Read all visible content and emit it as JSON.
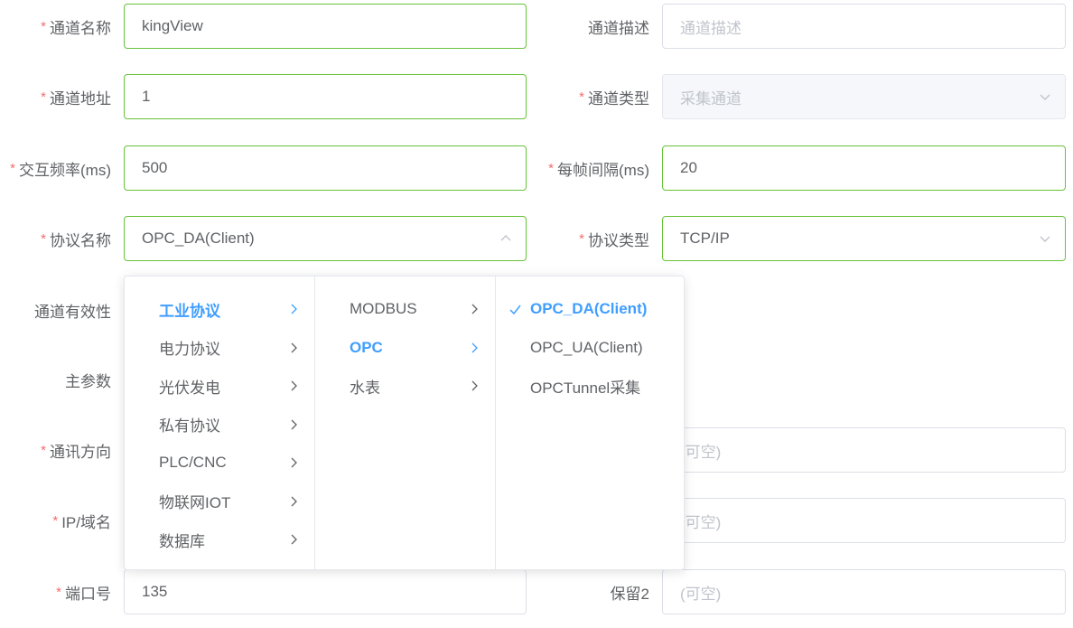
{
  "form": {
    "channel_name": {
      "label": "通道名称",
      "value": "kingView",
      "required": true
    },
    "channel_desc": {
      "label": "通道描述",
      "placeholder": "通道描述",
      "required": false
    },
    "channel_addr": {
      "label": "通道地址",
      "value": "1",
      "required": true
    },
    "channel_type": {
      "label": "通道类型",
      "placeholder": "采集通道",
      "required": true
    },
    "interact_freq": {
      "label": "交互频率(ms)",
      "value": "500",
      "required": true
    },
    "frame_interval": {
      "label": "每帧间隔(ms)",
      "value": "20",
      "required": true
    },
    "protocol_name": {
      "label": "协议名称",
      "value": "OPC_DA(Client)",
      "required": true
    },
    "protocol_type": {
      "label": "协议类型",
      "value": "TCP/IP",
      "required": true
    },
    "channel_validity": {
      "label": "通道有效性"
    },
    "main_param": {
      "label": "主参数"
    },
    "comm_direction": {
      "label": "通讯方向",
      "required": true
    },
    "right_field_1": {
      "placeholder": "(可空)"
    },
    "ip_domain": {
      "label": "IP/域名",
      "required": true
    },
    "right_field_2": {
      "placeholder": "(可空)"
    },
    "port": {
      "label": "端口号",
      "value": "135",
      "required": true
    },
    "reserve2": {
      "label": "保留2",
      "placeholder": "(可空)"
    }
  },
  "cascader": {
    "level1": [
      "工业协议",
      "电力协议",
      "光伏发电",
      "私有协议",
      "PLC/CNC",
      "物联网IOT",
      "数据库"
    ],
    "level2": [
      "MODBUS",
      "OPC",
      "水表"
    ],
    "level3": [
      "OPC_DA(Client)",
      "OPC_UA(Client)",
      "OPCTunnel采集"
    ]
  },
  "colors": {
    "required": "#f56c6c",
    "valid_border": "#67c23a",
    "active": "#409eff"
  },
  "icons": {
    "chevron-down": "chevron-down-icon",
    "chevron-up": "chevron-up-icon",
    "chevron-right": "chevron-right-icon",
    "check": "check-icon"
  }
}
